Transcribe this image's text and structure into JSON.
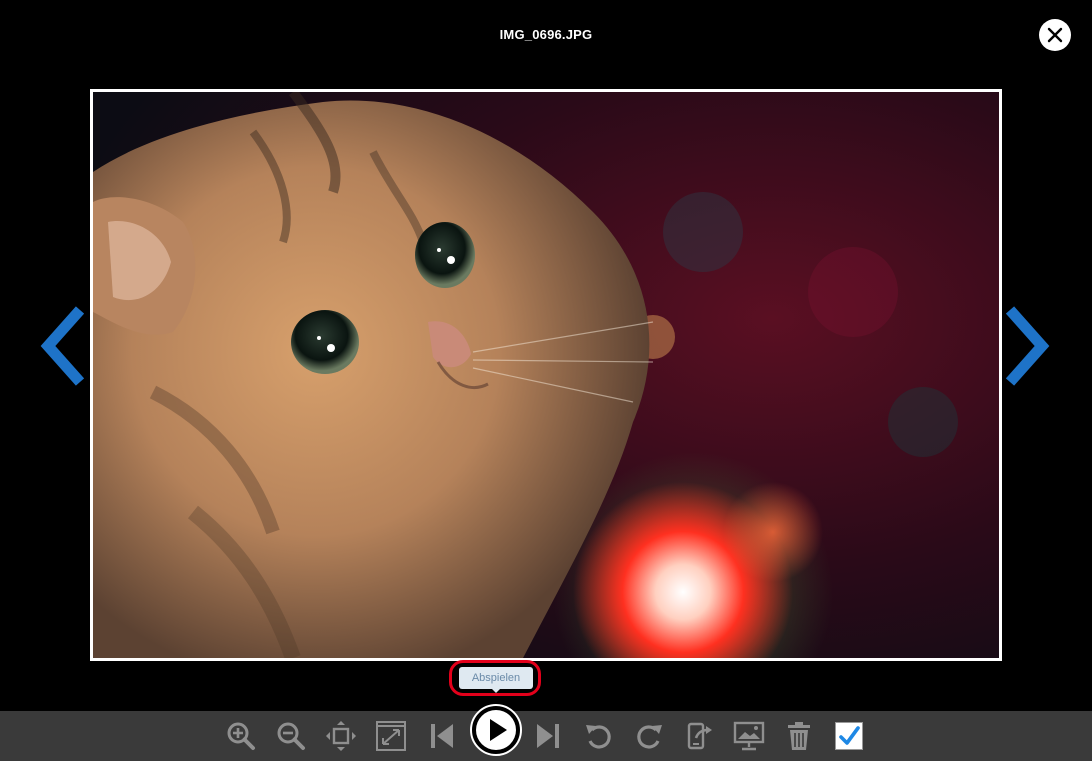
{
  "viewer": {
    "filename": "IMG_0696.JPG",
    "tooltip": "Abspielen"
  },
  "icons": {
    "close": "close-icon",
    "prev": "chevron-left-icon",
    "next": "chevron-right-icon",
    "zoom_in": "zoom-in-icon",
    "zoom_out": "zoom-out-icon",
    "fit": "fit-to-window-icon",
    "original_size": "original-size-icon",
    "first": "skip-to-first-icon",
    "play": "play-icon",
    "last": "skip-to-last-icon",
    "rotate_left": "rotate-left-icon",
    "rotate_right": "rotate-right-icon",
    "share": "share-icon",
    "set_wallpaper": "set-as-wallpaper-icon",
    "delete": "trash-icon",
    "select": "checkbox-checked-icon"
  },
  "colors": {
    "background": "#000000",
    "accent_arrows": "#1e73c8",
    "toolbar_bg": "#3a3a3a",
    "toolbar_icons": "#8f8f8f",
    "highlight": "#e3001b",
    "checkmark": "#1e88e5"
  }
}
